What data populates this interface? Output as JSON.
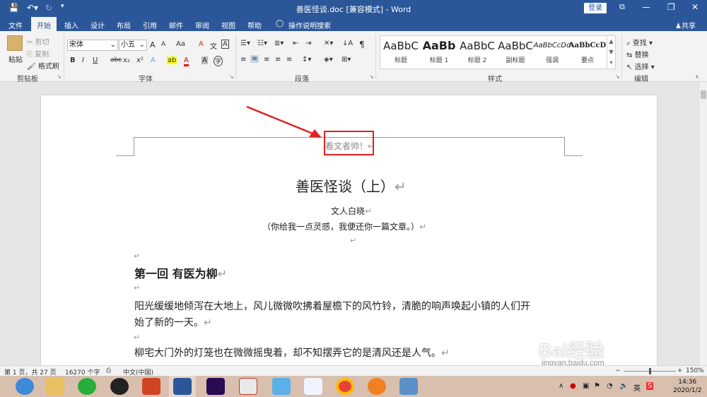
{
  "titlebar": {
    "title": "善医怪谈.doc [兼容模式] - Word",
    "login": "登录",
    "min": "—",
    "restore": "❐",
    "close": "✕",
    "ribbon_opts": "⧉"
  },
  "tabs": [
    "文件",
    "开始",
    "插入",
    "设计",
    "布局",
    "引用",
    "邮件",
    "审阅",
    "视图",
    "帮助",
    "操作说明搜索"
  ],
  "share": "共享",
  "ribbon": {
    "clipboard": {
      "paste": "粘贴",
      "cut": "剪切",
      "copy": "复制",
      "format_painter": "格式刷",
      "label": "剪贴板"
    },
    "font": {
      "family": "宋体",
      "size": "小五",
      "label": "字体",
      "grow": "A",
      "shrink": "A",
      "case": "Aa",
      "clear": "A",
      "wen": "文",
      "box": "A",
      "bold": "B",
      "italic": "I",
      "underline": "U",
      "strike": "abc",
      "sub": "x₂",
      "sup": "x²",
      "effects": "A",
      "highlight": "ab",
      "color": "A",
      "shade": "A",
      "circle": "字"
    },
    "paragraph": {
      "label": "段落",
      "sort": "↓A",
      "marks": "¶"
    },
    "styles": {
      "label": "样式",
      "items": [
        {
          "sample": "AaBbC",
          "name": "标题"
        },
        {
          "sample": "AaBb",
          "name": "标题 1"
        },
        {
          "sample": "AaBbC",
          "name": "标题 2"
        },
        {
          "sample": "AaBbC",
          "name": "副标题"
        },
        {
          "sample": "AaBbCcDd",
          "name": "强调"
        },
        {
          "sample": "AaBbCcD",
          "name": "要点"
        }
      ]
    },
    "editing": {
      "find": "查找",
      "replace": "替换",
      "select": "选择",
      "label": "编辑"
    }
  },
  "document": {
    "header": "看文者帅！",
    "title": "善医怪谈（上）",
    "author": "文人白晓",
    "subtitle": "（你给我一点灵感，我便还你一篇文章。）",
    "chapter": "第一回  有医为柳",
    "para1_line1": "阳光缓缓地倾泻在大地上，风儿微微吹拂着屋檐下的风竹铃，清脆的响声唤起小镇的人们开",
    "para1_line2": "始了新的一天。",
    "para2": "柳宅大门外的灯笼也在微微摇曳着，却不知摆弄它的是清风还是人气。",
    "pmark": "↵"
  },
  "status": {
    "page": "第 1 页，共 27 页",
    "words": "16270 个字",
    "lang": "中文(中国)",
    "zoom": "150%",
    "minus": "−",
    "plus": "+"
  },
  "taskbar": {
    "time": "14:36",
    "date": "2020/1/2",
    "ime": "英",
    "caret": "∧"
  },
  "watermark": {
    "brand": "Bai经验",
    "url": "jingyan.baidu.com"
  },
  "colors": {
    "accent": "#2b579a",
    "arrow": "#e02020"
  }
}
